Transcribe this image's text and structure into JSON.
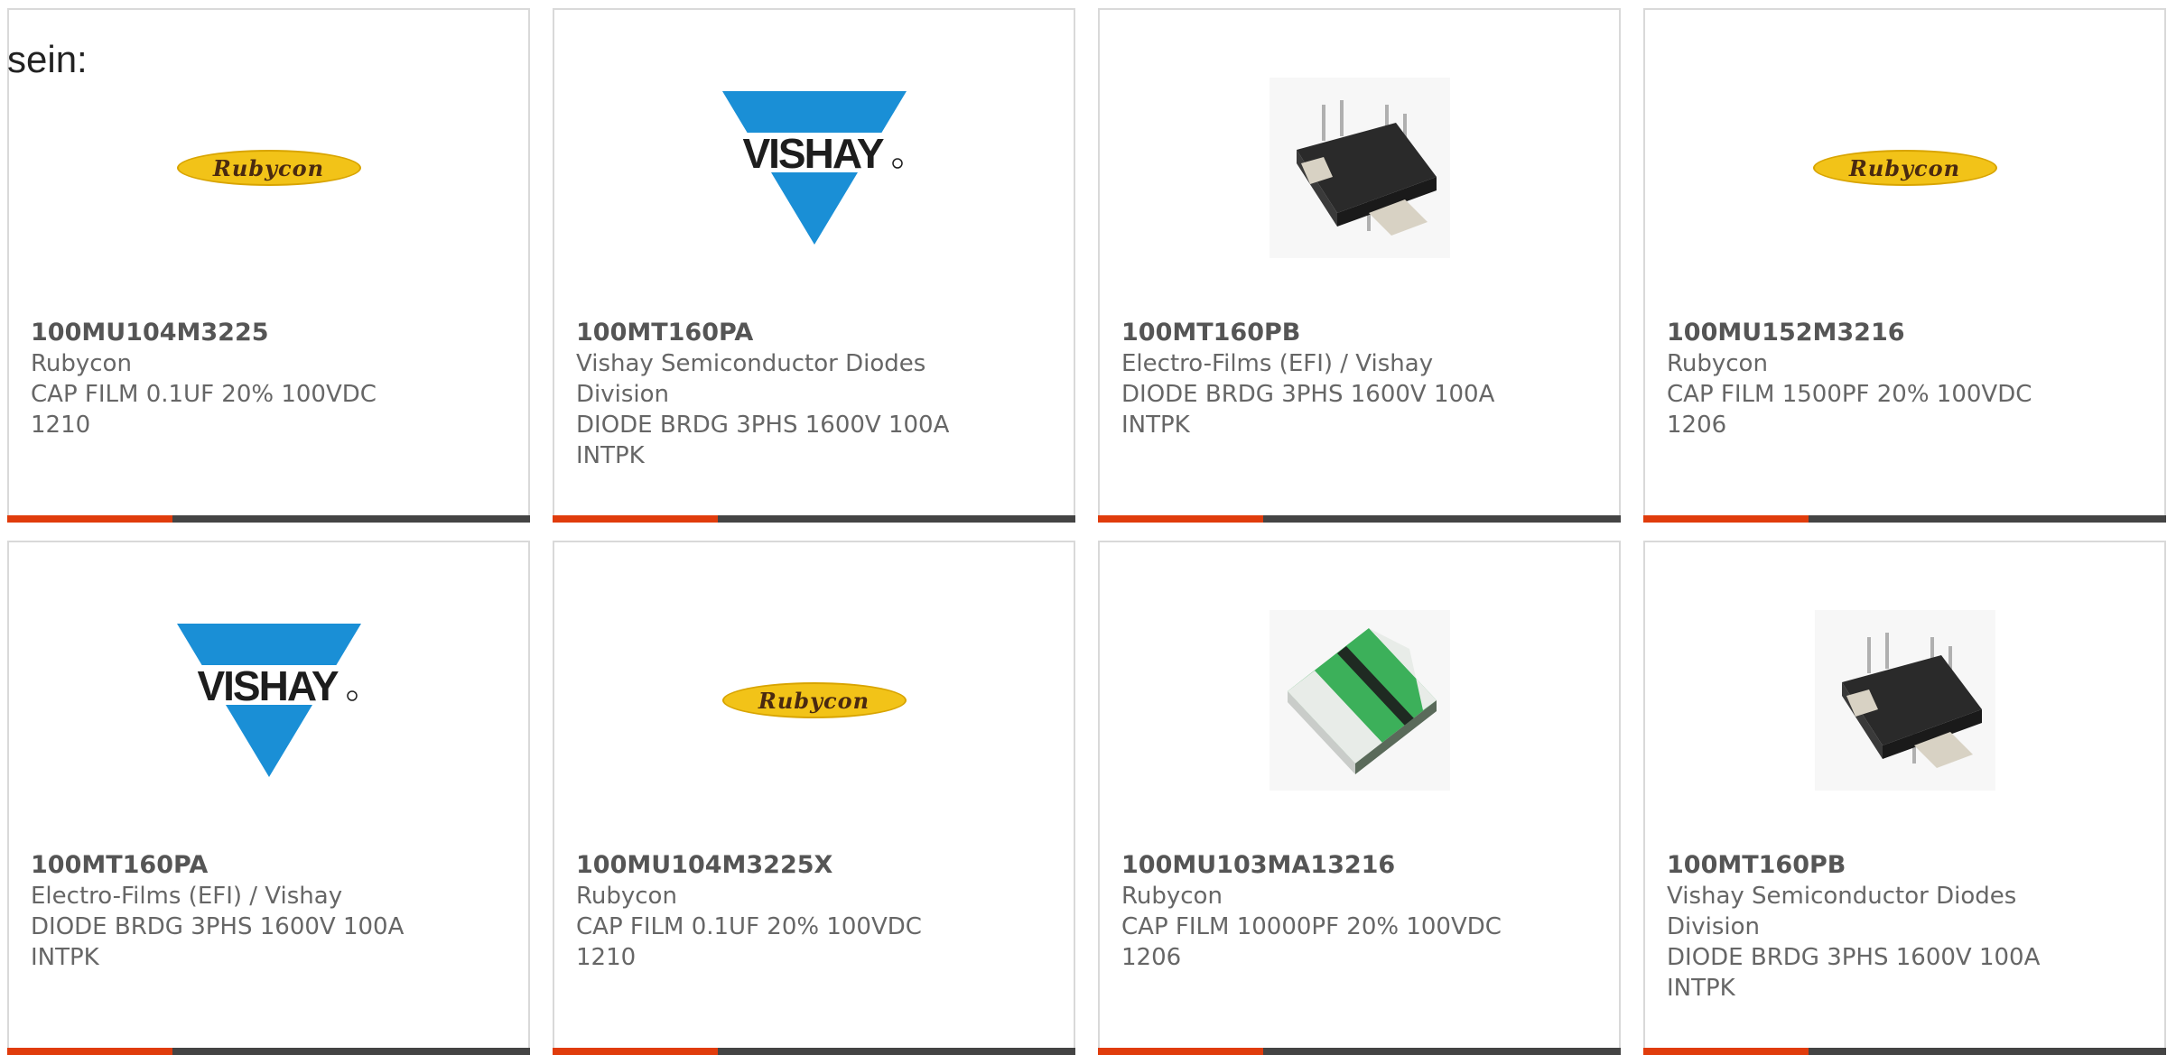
{
  "intro_text": "sein:",
  "products": [
    {
      "part_number": "100MU104M3225",
      "manufacturer": "Rubycon",
      "description_lines": [
        "CAP FILM 0.1UF 20% 100VDC",
        "1210"
      ],
      "image": "rubycon-logo",
      "logo_text": "Rubycon"
    },
    {
      "part_number": "100MT160PA",
      "manufacturer": "Vishay Semiconductor Diodes Division",
      "manufacturer_lines": [
        "Vishay Semiconductor Diodes",
        "Division"
      ],
      "description_lines": [
        "DIODE BRDG 3PHS 1600V 100A",
        "INTPK"
      ],
      "image": "vishay-logo",
      "logo_text": "VISHAY"
    },
    {
      "part_number": "100MT160PB",
      "manufacturer": "Electro-Films (EFI) / Vishay",
      "description_lines": [
        "DIODE BRDG 3PHS 1600V 100A",
        "INTPK"
      ],
      "image": "diode-module-photo"
    },
    {
      "part_number": "100MU152M3216",
      "manufacturer": "Rubycon",
      "description_lines": [
        "CAP FILM 1500PF 20% 100VDC",
        "1206"
      ],
      "image": "rubycon-logo",
      "logo_text": "Rubycon"
    },
    {
      "part_number": "100MT160PA",
      "manufacturer": "Electro-Films (EFI) / Vishay",
      "description_lines": [
        "DIODE BRDG 3PHS 1600V 100A",
        "INTPK"
      ],
      "image": "vishay-logo",
      "logo_text": "VISHAY"
    },
    {
      "part_number": "100MU104M3225X",
      "manufacturer": "Rubycon",
      "description_lines": [
        "CAP FILM 0.1UF 20% 100VDC",
        "1210"
      ],
      "image": "rubycon-logo",
      "logo_text": "Rubycon"
    },
    {
      "part_number": "100MU103MA13216",
      "manufacturer": "Rubycon",
      "description_lines": [
        "CAP FILM 10000PF 20% 100VDC",
        "1206"
      ],
      "image": "film-capacitor-photo"
    },
    {
      "part_number": "100MT160PB",
      "manufacturer": "Vishay Semiconductor Diodes Division",
      "manufacturer_lines": [
        "Vishay Semiconductor Diodes",
        "Division"
      ],
      "description_lines": [
        "DIODE BRDG 3PHS 1600V 100A",
        "INTPK"
      ],
      "image": "diode-module-photo"
    }
  ],
  "colors": {
    "accent": "#e03c0c",
    "bar": "#444444",
    "border": "#d9d9d9",
    "text": "#666666",
    "vishay_blue": "#1a8fd6",
    "rubycon_yellow": "#f2c318"
  }
}
